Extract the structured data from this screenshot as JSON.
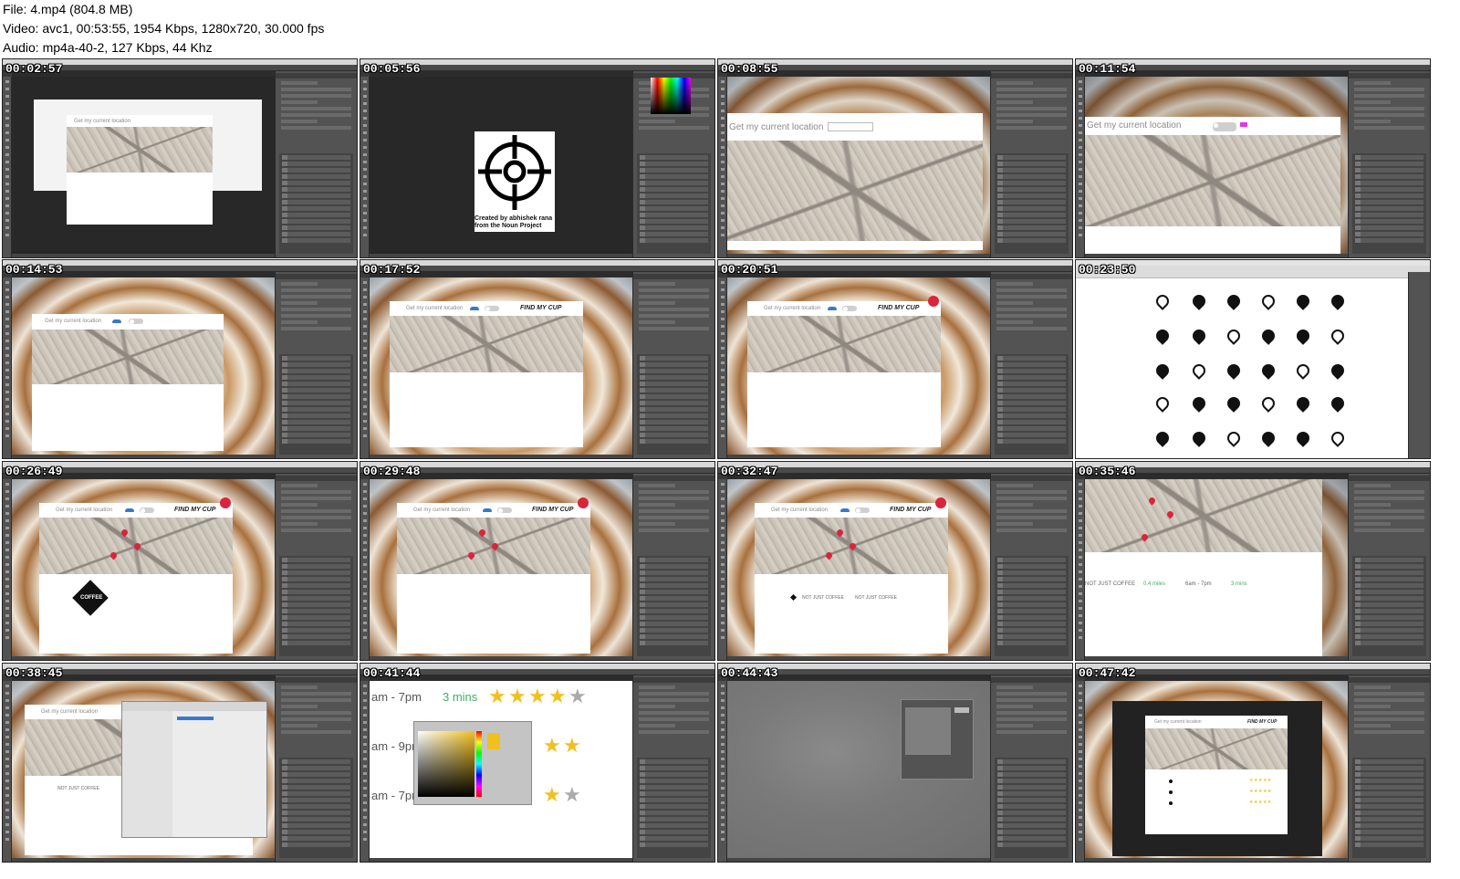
{
  "header": {
    "file_line": "File: 4.mp4 (804.8 MB)",
    "video_line": "Video: avc1, 00:53:55, 1954 Kbps, 1280x720, 30.000 fps",
    "audio_line": "Audio: mp4a-40-2, 127 Kbps, 44 Khz"
  },
  "thumbnails": [
    {
      "time": "00:02:57",
      "title": "Get my current location"
    },
    {
      "time": "00:05:56",
      "credit_line1": "Created by abhishek rana",
      "credit_line2": "from the Noun Project"
    },
    {
      "time": "00:08:55",
      "title": "Get my current location"
    },
    {
      "time": "00:11:54",
      "title": "Get my current location"
    },
    {
      "time": "00:14:53",
      "title": "Get my current location"
    },
    {
      "time": "00:17:52",
      "title": "Get my current location",
      "find": "FIND MY CUP"
    },
    {
      "time": "00:20:51",
      "title": "Get my current location",
      "find": "FIND MY CUP"
    },
    {
      "time": "00:23:50"
    },
    {
      "time": "00:26:49",
      "title": "Get my current location",
      "find": "FIND MY CUP",
      "logo": "COFFEE"
    },
    {
      "time": "00:29:48",
      "title": "Get my current location",
      "find": "FIND MY CUP"
    },
    {
      "time": "00:32:47",
      "title": "Get my current location",
      "find": "FIND MY CUP",
      "row1": "NOT JUST COFFEE",
      "row2": "NOT JUST COFFEE"
    },
    {
      "time": "00:35:46",
      "shop": "NOT JUST COFFEE",
      "dist": "0.4 miles",
      "hours": "6am - 7pm",
      "mins": "3 mins"
    },
    {
      "time": "00:38:45",
      "title": "Get my current location",
      "row": "NOT JUST COFFEE"
    },
    {
      "time": "00:41:44",
      "t1": "am - 7pm",
      "m1": "3 mins",
      "t2": "am - 9pm",
      "t3": "am - 7pm"
    },
    {
      "time": "00:44:43"
    },
    {
      "time": "00:47:42",
      "title": "Get my current location",
      "find": "FIND MY CUP"
    }
  ],
  "colors": {
    "accent_red": "#d9253c",
    "accent_green": "#3fae6a",
    "star_yellow": "#f2c01e",
    "photoshop_dark": "#282828"
  }
}
